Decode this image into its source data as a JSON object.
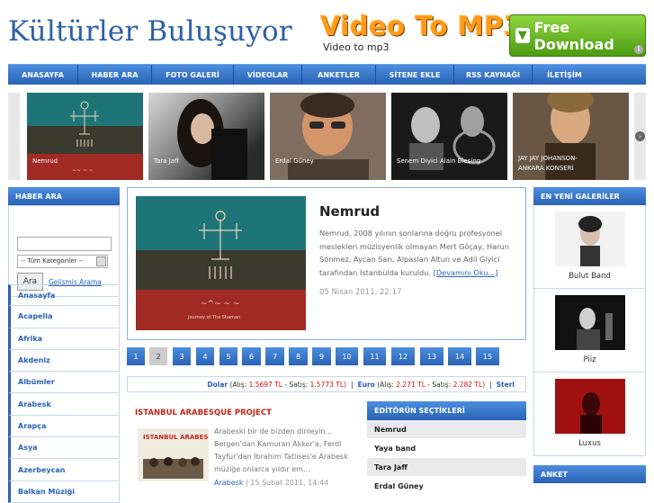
{
  "header": {
    "logo": "Kültürler Buluşuyor",
    "ad_title": "Video To MP3",
    "ad_subtitle": "Video to mp3",
    "ad_button": "Free Download",
    "ad_info": "i"
  },
  "nav": {
    "items": [
      "ANASAYFA",
      "HABER ARA",
      "FOTO GALERİ",
      "VİDEOLAR",
      "ANKETLER",
      "SİTENE EKLE",
      "RSS KAYNAĞI",
      "İLETİŞİM"
    ]
  },
  "slider": {
    "prev": "‹",
    "next": "›",
    "slides": [
      {
        "caption": "Nemrud"
      },
      {
        "caption": "Tara Jaff"
      },
      {
        "caption": "Erdal Güney"
      },
      {
        "caption": "Senem Diyici Alain Blesing"
      },
      {
        "caption": "JAY JAY JOHANSON-",
        "caption2": "ANKARA KONSERİ"
      }
    ]
  },
  "search": {
    "title": "HABER ARA",
    "input_value": "",
    "category": "-- Tüm Kategoriler --",
    "button": "Ara",
    "advanced": "Gelişmiş Arama"
  },
  "categories": [
    "Anasayfa",
    "Acapella",
    "Afrika",
    "Akdeniz",
    "Albümler",
    "Arabesk",
    "Arapça",
    "Asya",
    "Azerbeycan",
    "Balkan Müziği"
  ],
  "featured": {
    "title": "Nemrud",
    "text": "Nemrud, 2008 yılının sonlarına doğru profesyonel meslekleri müzisyenlik olmayan Mert Göçay, Harun Sönmez, Aycan Sarı, Alpaslan Altun ve Adil Giyici tarafından İstanbulda kuruldu.",
    "more": "[Devamını Oku...]",
    "date": "05 Nisan 2011, 22:17",
    "img_text": "Journey of The Shaman"
  },
  "pager": {
    "pages": [
      "1",
      "2",
      "3",
      "4",
      "5",
      "6",
      "7",
      "8",
      "9",
      "10",
      "11",
      "12",
      "13",
      "14",
      "15"
    ],
    "active": "2"
  },
  "ticker": {
    "dolar_label": "Dolar",
    "dolar_alis_label": "(Alış:",
    "dolar_alis": "1.5697 TL",
    "dolar_satis_label": "- Satış:",
    "dolar_satis": "1.5773 TL)",
    "euro_label": "Euro",
    "euro_alis_label": "(Alış:",
    "euro_alis": "2.271 TL",
    "euro_satis_label": "- Satış:",
    "euro_satis": "2.282 TL)",
    "sterlin_label": "Sterl",
    "sep": "|"
  },
  "news": {
    "title": "ISTANBUL ARABESQUE PROJECT",
    "text": "Arabeski bir de bizden dinleyin... Bergen'dan Kamuran Akkor'a, Ferdi Tayfur'dan İbrahim Tatlıses'e Arabesk müziğe onlarca yıldır em...",
    "category": "Arabesk",
    "date": "| 15 Şubat 2011, 14:44",
    "img_text": "ISTANBUL ARABESQUE PROJECT"
  },
  "editor": {
    "title": "EDİTÖRÜN SEÇTİKLERİ",
    "items": [
      "Nemrud",
      "Yaya band",
      "Tara Jaff",
      "Erdal Güney"
    ]
  },
  "galleries": {
    "title": "EN YENİ GALERİLER",
    "items": [
      "Bulut Band",
      "Piiz",
      "Luxus"
    ]
  },
  "poll": {
    "title": "ANKET"
  },
  "colors": {
    "brand_blue": "#2a62b6",
    "accent_red": "#c0271b",
    "ad_orange": "#ff9a1a",
    "ad_green": "#4c9c12"
  }
}
